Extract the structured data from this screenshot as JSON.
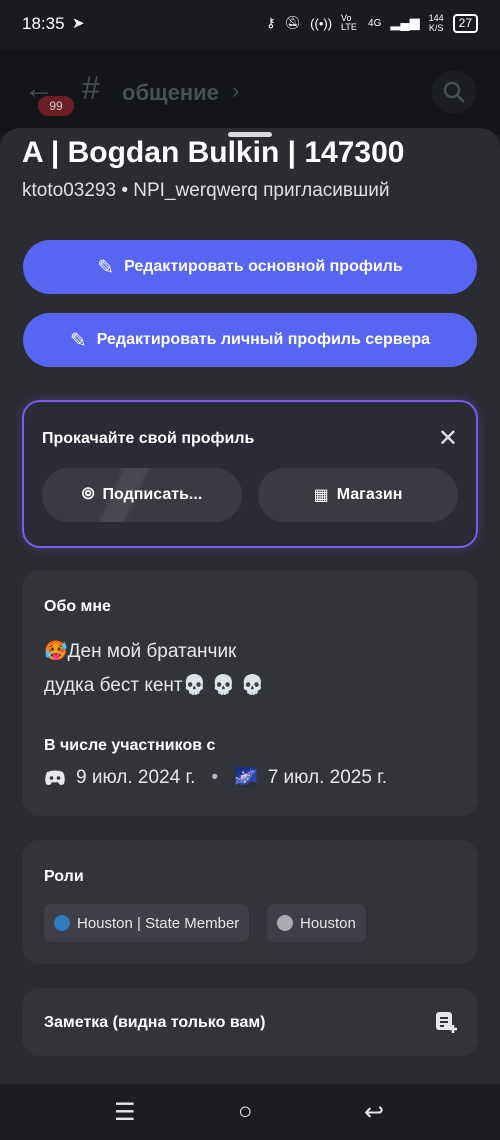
{
  "status_bar": {
    "time": "18:35",
    "network_volte": "Vo LTE",
    "network_4g": "4G",
    "speed_value": "144",
    "speed_unit": "K/S",
    "battery": "27"
  },
  "channel_header": {
    "unread_badge": "99",
    "hash": "#",
    "channel_name": "общение"
  },
  "profile": {
    "display_name": "A | Bogdan Bulkin | 147300",
    "username": "ktoto03293",
    "separator": "•",
    "invited_by": "NPI_werqwerq пригласивший"
  },
  "buttons": {
    "edit_main": "Редактировать основной профиль",
    "edit_server": "Редактировать личный профиль сервера"
  },
  "upgrade": {
    "title": "Прокачайте свой профиль",
    "subscribe_label": "Подписать...",
    "shop_label": "Магазин"
  },
  "about": {
    "title": "Обо мне",
    "line1_emoji": "🥵",
    "line1_text": "Ден мой братанчик",
    "line2_text": "дудка бест кент",
    "line2_emoji": "💀 💀 💀",
    "member_since_title": "В числе участников с",
    "discord_date": "9 июл. 2024 г.",
    "dot": "•",
    "server_icon_emoji": "🌌",
    "server_date": "7 июл. 2025 г."
  },
  "roles": {
    "title": "Роли",
    "items": [
      {
        "name": "Houston | State Member",
        "color": "#2f7bbf"
      },
      {
        "name": "Houston",
        "color": "#a9abb0"
      }
    ]
  },
  "note": {
    "title": "Заметка (видна только вам)"
  },
  "colors": {
    "accent": "#5865f2",
    "upgrade_border": "#7a5cf0",
    "card_bg": "#33343a",
    "sheet_bg": "#2b2c31"
  },
  "icons": {
    "edit": "pencil-icon",
    "subscribe": "nitro-icon",
    "shop": "shop-icon",
    "discord": "discord-icon",
    "note": "note-add-icon",
    "search": "search-icon",
    "close": "close-icon"
  }
}
